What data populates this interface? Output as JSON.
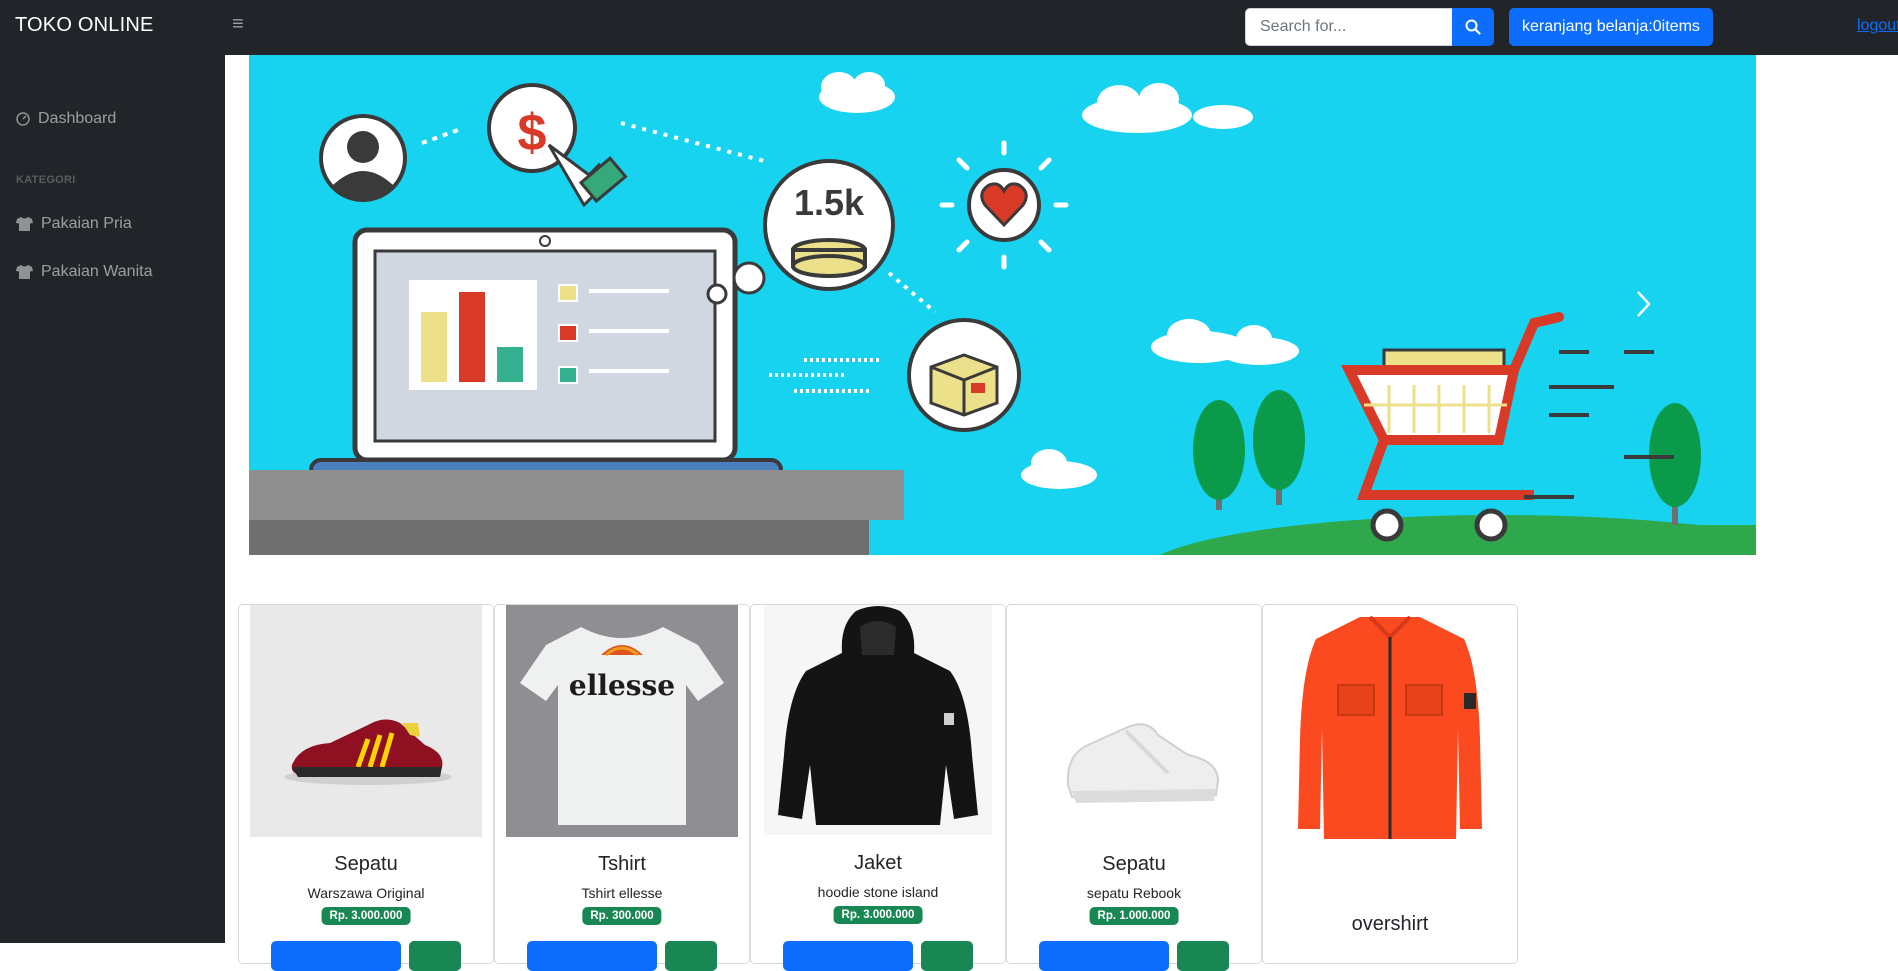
{
  "navbar": {
    "brand": "TOKO ONLINE",
    "toggle_icon": "≡",
    "search_placeholder": "Search for...",
    "cart_label": "keranjang belanja:0items",
    "logout_label": "logout"
  },
  "sidebar": {
    "dashboard_label": "Dashboard",
    "heading": "KATEGORI",
    "items": [
      {
        "label": "Pakaian Pria",
        "icon": "tshirt-icon"
      },
      {
        "label": "Pakaian Wanita",
        "icon": "tshirt-icon"
      }
    ]
  },
  "banner": {
    "coin_label": "1.5k",
    "dollar_label": "$"
  },
  "products": [
    {
      "title": "Sepatu",
      "subtitle": "Warszawa Original",
      "price": "Rp. 3.000.000",
      "image": "red-sneaker"
    },
    {
      "title": "Tshirt",
      "subtitle": "Tshirt ellesse",
      "price": "Rp. 300.000",
      "image": "white-tshirt",
      "brand_print": "ellesse"
    },
    {
      "title": "Jaket",
      "subtitle": "hoodie stone island",
      "price": "Rp. 3.000.000",
      "image": "black-hoodie"
    },
    {
      "title": "Sepatu",
      "subtitle": "sepatu Rebook",
      "price": "Rp. 1.000.000",
      "image": "white-sneaker"
    },
    {
      "title": "overshirt",
      "subtitle": "",
      "price": "",
      "image": "orange-overshirt"
    }
  ],
  "colors": {
    "navbar": "#212529",
    "primary": "#0d6efd",
    "success": "#198754",
    "banner_bg": "#17d3ef"
  }
}
